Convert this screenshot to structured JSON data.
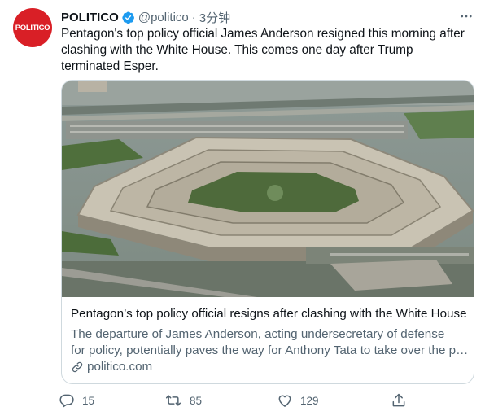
{
  "author": {
    "avatar_text": "POLITICO",
    "name": "POLITICO",
    "handle": "@politico",
    "separator": "·",
    "time": "3分钟"
  },
  "tweet": {
    "text": "Pentagon's top policy official James Anderson resigned this morning after clashing with the White House. This comes one day after Trump terminated Esper."
  },
  "card": {
    "title": "Pentagon’s top policy official resigns after clashing with the White House",
    "description_line1": "The departure of James Anderson, acting undersecretary of defense",
    "description_line2": "for policy, potentially paves the way for Anthony Tata to take over the position.",
    "domain": "politico.com"
  },
  "actions": {
    "reply_count": "15",
    "retweet_count": "85",
    "like_count": "129"
  },
  "colors": {
    "brand": "#d91f26",
    "verified": "#1d9bf0",
    "secondary_text": "#536471"
  },
  "icons": [
    "verified-badge-icon",
    "more-icon",
    "link-icon",
    "reply-icon",
    "retweet-icon",
    "like-icon",
    "share-icon"
  ]
}
